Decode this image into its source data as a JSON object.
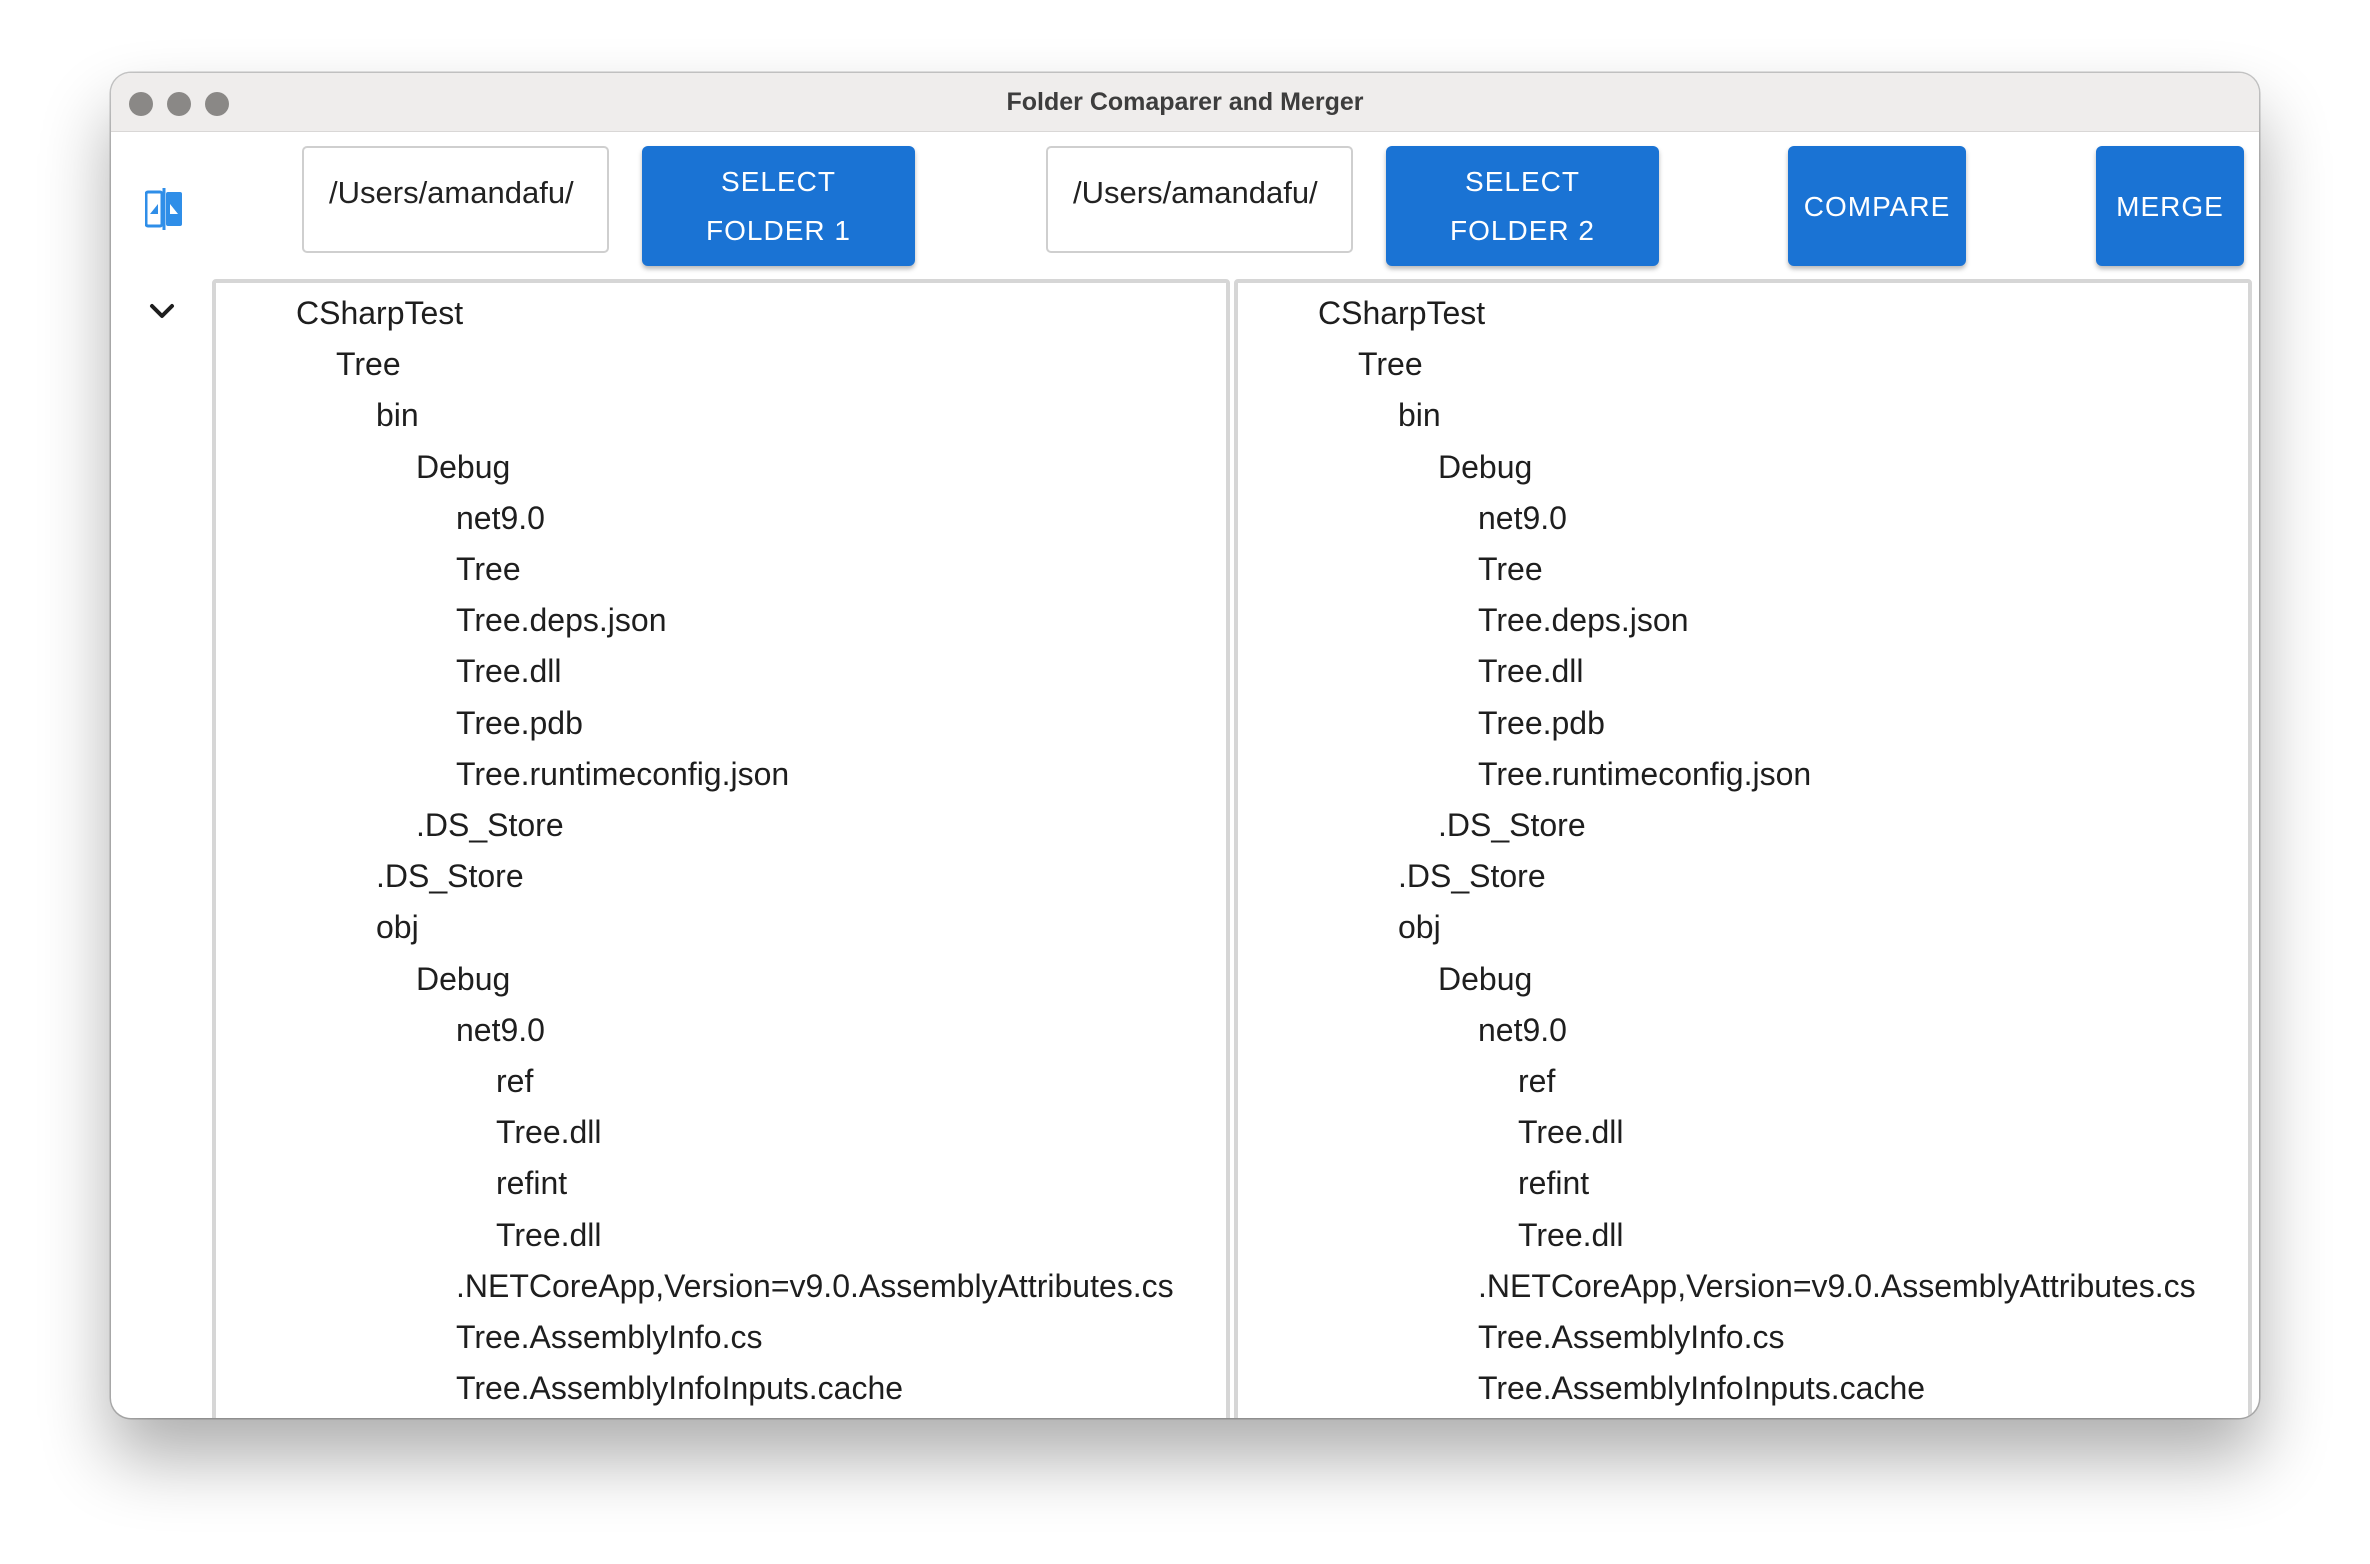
{
  "window": {
    "title": "Folder Comaparer and Merger"
  },
  "toolbar": {
    "folder1_path": "/Users/amandafu/",
    "select_folder1_line1": "SELECT",
    "select_folder1_line2": "FOLDER 1",
    "folder2_path": "/Users/amandafu/",
    "select_folder2_line1": "SELECT",
    "select_folder2_line2": "FOLDER 2",
    "compare_label": "COMPARE",
    "merge_label": "MERGE",
    "sidebar_icon": "compare-panels-icon",
    "collapse_icon": "chevron-down-icon"
  },
  "colors": {
    "accent": "#1a73d4",
    "icon": "#2f8ee8"
  },
  "trees": {
    "left": [
      {
        "name": "CSharpTest",
        "level": 0
      },
      {
        "name": "Tree",
        "level": 1
      },
      {
        "name": "bin",
        "level": 2
      },
      {
        "name": "Debug",
        "level": 3
      },
      {
        "name": "net9.0",
        "level": 4
      },
      {
        "name": "Tree",
        "level": 4
      },
      {
        "name": "Tree.deps.json",
        "level": 4
      },
      {
        "name": "Tree.dll",
        "level": 4
      },
      {
        "name": "Tree.pdb",
        "level": 4
      },
      {
        "name": "Tree.runtimeconfig.json",
        "level": 4
      },
      {
        "name": ".DS_Store",
        "level": 3
      },
      {
        "name": ".DS_Store",
        "level": 2
      },
      {
        "name": "obj",
        "level": 2
      },
      {
        "name": "Debug",
        "level": 3
      },
      {
        "name": "net9.0",
        "level": 4
      },
      {
        "name": "ref",
        "level": 5
      },
      {
        "name": "Tree.dll",
        "level": 5
      },
      {
        "name": "refint",
        "level": 5
      },
      {
        "name": "Tree.dll",
        "level": 5
      },
      {
        "name": ".NETCoreApp,Version=v9.0.AssemblyAttributes.cs",
        "level": 4
      },
      {
        "name": "Tree.AssemblyInfo.cs",
        "level": 4
      },
      {
        "name": "Tree.AssemblyInfoInputs.cache",
        "level": 4
      }
    ],
    "right": [
      {
        "name": "CSharpTest",
        "level": 0
      },
      {
        "name": "Tree",
        "level": 1
      },
      {
        "name": "bin",
        "level": 2
      },
      {
        "name": "Debug",
        "level": 3
      },
      {
        "name": "net9.0",
        "level": 4
      },
      {
        "name": "Tree",
        "level": 4
      },
      {
        "name": "Tree.deps.json",
        "level": 4
      },
      {
        "name": "Tree.dll",
        "level": 4
      },
      {
        "name": "Tree.pdb",
        "level": 4
      },
      {
        "name": "Tree.runtimeconfig.json",
        "level": 4
      },
      {
        "name": ".DS_Store",
        "level": 3
      },
      {
        "name": ".DS_Store",
        "level": 2
      },
      {
        "name": "obj",
        "level": 2
      },
      {
        "name": "Debug",
        "level": 3
      },
      {
        "name": "net9.0",
        "level": 4
      },
      {
        "name": "ref",
        "level": 5
      },
      {
        "name": "Tree.dll",
        "level": 5
      },
      {
        "name": "refint",
        "level": 5
      },
      {
        "name": "Tree.dll",
        "level": 5
      },
      {
        "name": ".NETCoreApp,Version=v9.0.AssemblyAttributes.cs",
        "level": 4
      },
      {
        "name": "Tree.AssemblyInfo.cs",
        "level": 4
      },
      {
        "name": "Tree.AssemblyInfoInputs.cache",
        "level": 4
      }
    ]
  }
}
